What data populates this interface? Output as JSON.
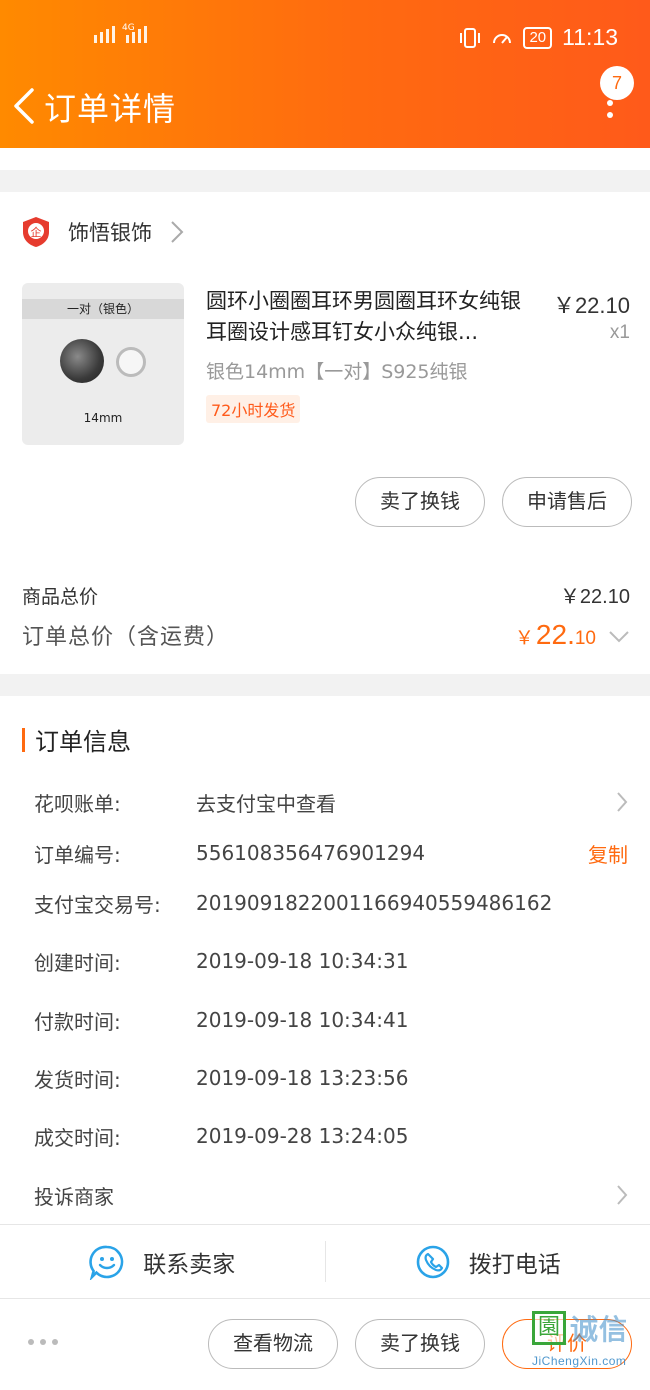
{
  "status_bar": {
    "network": "4G",
    "battery": "20",
    "time": "11:13"
  },
  "header": {
    "title": "订单详情",
    "badge_count": "7"
  },
  "shop": {
    "name": "饰悟银饰",
    "logo_text": "企"
  },
  "product": {
    "image_label_top": "一对（银色）",
    "image_label_bottom": "14mm",
    "title": "圆环小圈圈耳环男圆圈耳环女纯银耳圈设计感耳钉女小众纯银...",
    "price": "￥22.10",
    "quantity": "x1",
    "spec": "银色14mm【一对】S925纯银",
    "tag": "72小时发货"
  },
  "item_actions": {
    "sell_label": "卖了换钱",
    "after_sale_label": "申请售后"
  },
  "summary": {
    "goods_total_label": "商品总价",
    "goods_total_value": "￥22.10",
    "order_total_label": "订单总价（含运费）",
    "order_total_currency": "￥",
    "order_total_integer": "22.",
    "order_total_decimal": "10"
  },
  "order_info": {
    "section_title": "订单信息",
    "rows": [
      {
        "key": "花呗账单:",
        "value": "去支付宝中查看"
      },
      {
        "key": "订单编号:",
        "value": "556108356476901294",
        "action": "复制"
      },
      {
        "key": "支付宝交易号:",
        "value": "2019091822001166940559486162"
      },
      {
        "key": "创建时间:",
        "value": "2019-09-18 10:34:31"
      },
      {
        "key": "付款时间:",
        "value": "2019-09-18 10:34:41"
      },
      {
        "key": "发货时间:",
        "value": "2019-09-18 13:23:56"
      },
      {
        "key": "成交时间:",
        "value": "2019-09-28 13:24:05"
      },
      {
        "key": "投诉商家",
        "value": ""
      }
    ]
  },
  "contact": {
    "seller_label": "联系卖家",
    "call_label": "拨打电话"
  },
  "bottom_bar": {
    "logistics_label": "查看物流",
    "sell_label": "卖了换钱",
    "rate_label": "评价"
  },
  "watermark": {
    "logo_char": "園",
    "name": "诚信",
    "url": "JiChengXin.com"
  },
  "colors": {
    "accent": "#ff6a10",
    "header_start": "#ff8a00",
    "header_end": "#ff5a1a"
  }
}
